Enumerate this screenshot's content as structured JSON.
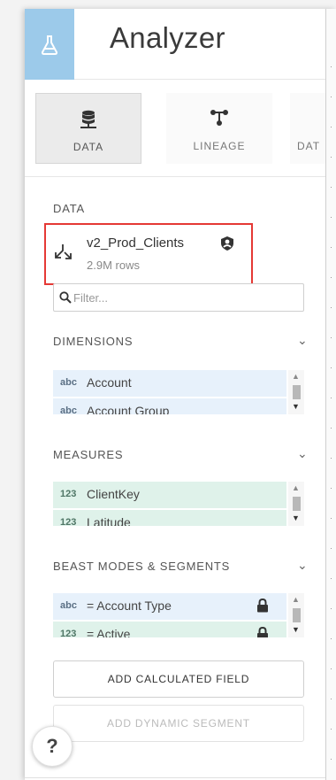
{
  "app": {
    "title": "Analyzer",
    "logo_icon": "flask-icon",
    "accent": "#9ccaea"
  },
  "tabs": [
    {
      "label": "DATA",
      "icon": "database-icon",
      "active": true
    },
    {
      "label": "LINEAGE",
      "icon": "lineage-icon",
      "active": false
    },
    {
      "label": "DAT",
      "icon": "",
      "active": false
    }
  ],
  "data_section": {
    "heading": "DATA",
    "dataset_name": "v2_Prod_Clients",
    "dataset_rows": "2.9M rows",
    "highlight_color": "#e53935"
  },
  "filter": {
    "placeholder": "Filter...",
    "value": ""
  },
  "dimensions": {
    "heading": "DIMENSIONS",
    "items": [
      {
        "type": "abc",
        "name": "Account"
      },
      {
        "type": "abc",
        "name": "Account Group"
      }
    ]
  },
  "measures": {
    "heading": "MEASURES",
    "items": [
      {
        "type": "123",
        "name": "ClientKey"
      },
      {
        "type": "123",
        "name": "Latitude"
      }
    ]
  },
  "beast_modes": {
    "heading": "BEAST MODES & SEGMENTS",
    "items": [
      {
        "type": "abc",
        "name": "= Account Type",
        "locked": true
      },
      {
        "type": "123",
        "name": "= Active",
        "locked": true
      }
    ]
  },
  "buttons": {
    "add_calculated_field": "ADD CALCULATED FIELD",
    "add_dynamic_segment": "ADD DYNAMIC SEGMENT"
  },
  "help": {
    "label": "?"
  },
  "colors": {
    "dimension_bg": "#e7f1fb",
    "measure_bg": "#dff2ea"
  }
}
